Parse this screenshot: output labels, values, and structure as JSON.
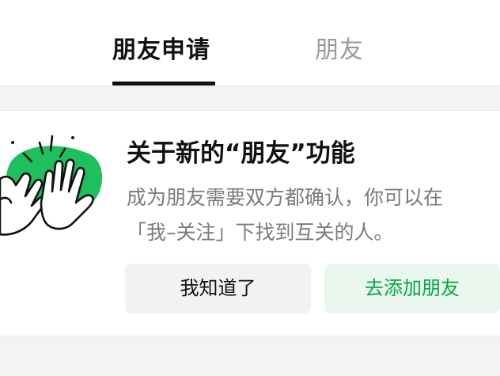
{
  "tabs": [
    {
      "label": "朋友申请",
      "active": true
    },
    {
      "label": "朋友",
      "active": false
    }
  ],
  "card": {
    "title": "关于新的“朋友”功能",
    "description_line1": "成为朋友需要双方都确认，你可以在",
    "description_line2": "「我–关注」下找到互关的人。",
    "illustration_icon": "high-five-hands-icon",
    "buttons": {
      "ok_label": "我知道了",
      "add_label": "去添加朋友"
    }
  },
  "colors": {
    "accent_green": "#07a63f",
    "accent_green_bg": "#e9f7ee",
    "tab_active": "#111111",
    "tab_inactive": "#9a9a9a"
  }
}
